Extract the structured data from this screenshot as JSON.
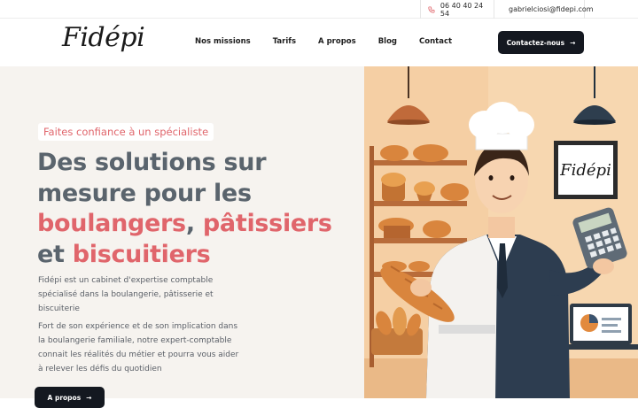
{
  "topbar": {
    "phone": "06 40 40 24 54",
    "email": "gabrielciosi@fidepi.com"
  },
  "header": {
    "logo": "Fidépi",
    "nav": [
      "Nos missions",
      "Tarifs",
      "A propos",
      "Blog",
      "Contact"
    ],
    "cta_label": "Contactez-nous"
  },
  "hero": {
    "badge": "Faites confiance à un spécialiste",
    "headline": {
      "line1": "Des solutions sur",
      "line2": "mesure pour les",
      "accent1": "boulangers",
      "comma": ", ",
      "accent2": "pâtissiers",
      "conj": "et ",
      "accent3": "biscuitiers"
    },
    "paragraph1": "Fidépi est un cabinet d'expertise comptable spécialisé dans la boulangerie, pâtisserie et biscuiterie",
    "paragraph2": "Fort de son expérience et de son implication dans la boulangerie familiale, notre expert-comptable connait les réalités du métier et pourra vous aider à relever les défis du quotidien",
    "button_label": "A propos",
    "illustration_sign": "Fidépi"
  },
  "colors": {
    "accent": "#e0656b",
    "dark": "#141820",
    "headline_gray": "#5a646d"
  }
}
